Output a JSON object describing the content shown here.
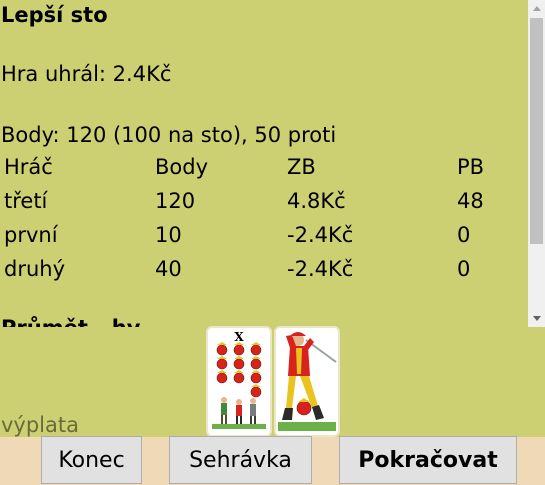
{
  "results": {
    "title": "Lepší sto",
    "winner_line": "Hra uhrál: 2.4Kč",
    "points_line": "Body: 120 (100 na sto), 50 proti",
    "table": {
      "headers": [
        "Hráč",
        "Body",
        "ZB",
        "PB"
      ],
      "rows": [
        [
          "třetí",
          "120",
          "4.8Kč",
          "48"
        ],
        [
          "první",
          "10",
          "-2.4Kč",
          "0"
        ],
        [
          "druhý",
          "40",
          "-2.4Kč",
          "0"
        ]
      ]
    },
    "cut_heading": "Průmět...hy"
  },
  "cards": [
    {
      "name": "X",
      "suit_icon": "hearts-ten-card"
    },
    {
      "name": "",
      "suit_icon": "hearts-lower-card"
    }
  ],
  "status": "výplata",
  "buttons": {
    "konec": "Konec",
    "sehravka": "Sehrávka",
    "pokracovat": "Pokračovat"
  },
  "colors": {
    "background": "#cdd072",
    "button_bar": "#f0d9b6",
    "button_face": "#e1e1e1",
    "card_red": "#d8231c"
  }
}
